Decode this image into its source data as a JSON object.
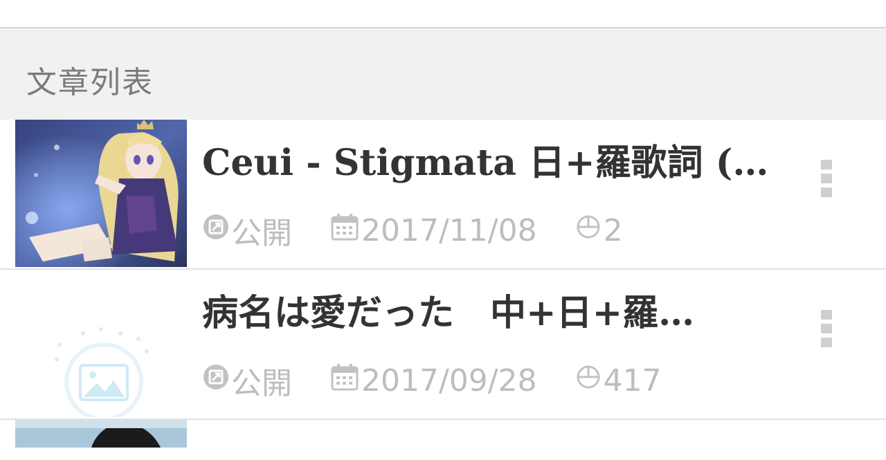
{
  "section": {
    "title": "文章列表"
  },
  "posts": [
    {
      "title": "Ceui - Stigmata 日+羅歌詞 (…",
      "visibility": "公開",
      "date": "2017/11/08",
      "views": "2",
      "thumbnail": "anime-illustration"
    },
    {
      "title": "病名は愛だった　中+日+羅…",
      "visibility": "公開",
      "date": "2017/09/28",
      "views": "417",
      "thumbnail": "placeholder-image-icon"
    }
  ],
  "icons": {
    "visibility": "public-icon",
    "date": "calendar-icon",
    "views": "views-icon",
    "menu": "more-vertical-icon"
  },
  "colors": {
    "header_bg": "#f1f1f1",
    "title_text": "#333333",
    "meta_text": "#bdbdbd",
    "placeholder_accent": "#bfe6f2"
  }
}
